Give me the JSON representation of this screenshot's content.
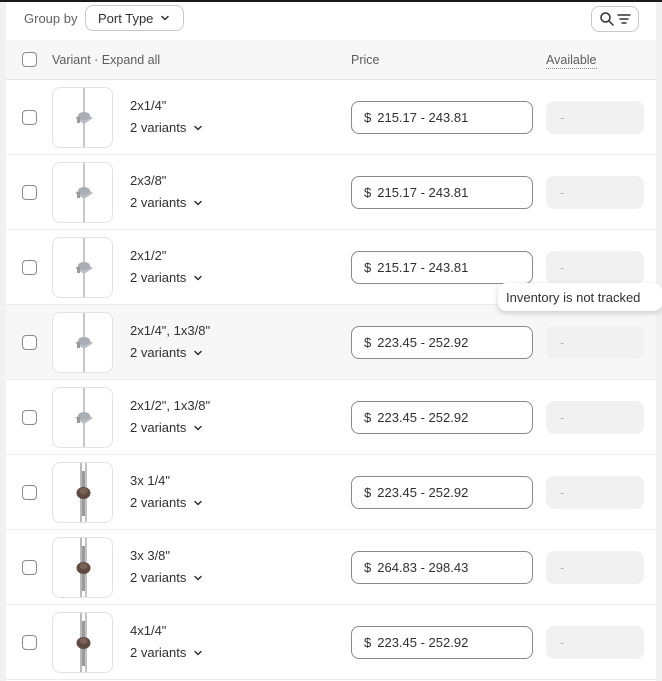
{
  "toolbar": {
    "group_label": "Group by",
    "group_value": "Port Type"
  },
  "header": {
    "variant": "Variant · Expand all",
    "price": "Price",
    "available": "Available"
  },
  "rows": [
    {
      "name": "2x1/4\"",
      "variants": "2 variants",
      "currency": "$",
      "price": "215.17 - 243.81",
      "available": "-",
      "image": "silver-fitting"
    },
    {
      "name": "2x3/8\"",
      "variants": "2 variants",
      "currency": "$",
      "price": "215.17 - 243.81",
      "available": "-",
      "image": "silver-fitting"
    },
    {
      "name": "2x1/2\"",
      "variants": "2 variants",
      "currency": "$",
      "price": "215.17 - 243.81",
      "available": "-",
      "image": "silver-fitting"
    },
    {
      "name": "2x1/4\", 1x3/8\"",
      "variants": "2 variants",
      "currency": "$",
      "price": "223.45 - 252.92",
      "available": "-",
      "image": "silver-fitting"
    },
    {
      "name": "2x1/2\", 1x3/8\"",
      "variants": "2 variants",
      "currency": "$",
      "price": "223.45 - 252.92",
      "available": "-",
      "image": "silver-fitting"
    },
    {
      "name": "3x 1/4\"",
      "variants": "2 variants",
      "currency": "$",
      "price": "223.45 - 252.92",
      "available": "-",
      "image": "brown-fitting"
    },
    {
      "name": "3x 3/8\"",
      "variants": "2 variants",
      "currency": "$",
      "price": "264.83 - 298.43",
      "available": "-",
      "image": "brown-fitting"
    },
    {
      "name": "4x1/4\"",
      "variants": "2 variants",
      "currency": "$",
      "price": "223.45 - 252.92",
      "available": "-",
      "image": "brown-fitting"
    }
  ],
  "tooltip": "Inventory is not tracked",
  "colors": {
    "page_bg": "#f1f1f1",
    "panel_bg": "#ffffff",
    "border": "#8a8a8a",
    "text": "#303030"
  }
}
